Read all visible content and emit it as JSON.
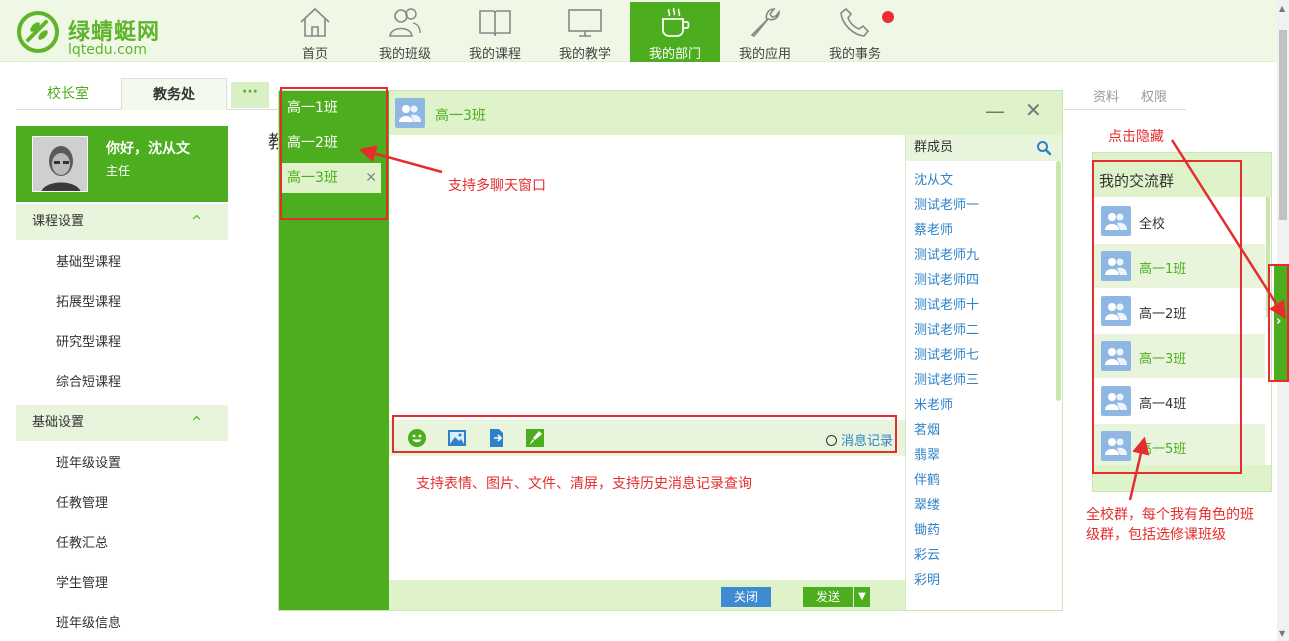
{
  "header": {
    "logo_cn": "绿蜻蜓网",
    "logo_en": "lqtedu.com",
    "nav": [
      {
        "label": "首页",
        "icon": "home-icon"
      },
      {
        "label": "我的班级",
        "icon": "users-icon"
      },
      {
        "label": "我的课程",
        "icon": "book-icon"
      },
      {
        "label": "我的教学",
        "icon": "monitor-icon"
      },
      {
        "label": "我的部门",
        "icon": "coffee-icon",
        "active": true
      },
      {
        "label": "我的应用",
        "icon": "wrench-icon"
      },
      {
        "label": "我的事务",
        "icon": "phone-icon",
        "badge": "red-dot"
      }
    ]
  },
  "tabs": {
    "items": [
      "校长室",
      "教务处"
    ],
    "more": "···",
    "right_links": [
      "资料",
      "权限"
    ]
  },
  "profile": {
    "greeting": "你好，沈从文",
    "role": "主任"
  },
  "sidebar": {
    "sections": [
      {
        "title": "课程设置",
        "items": [
          "基础型课程",
          "拓展型课程",
          "研究型课程",
          "综合短课程"
        ]
      },
      {
        "title": "基础设置",
        "items": [
          "班年级设置",
          "任教管理",
          "任教汇总",
          "学生管理",
          "班年级信息"
        ]
      }
    ],
    "chevron": "^"
  },
  "page": {
    "title_fragment": "教"
  },
  "chat": {
    "tabs": [
      "高一1班",
      "高一2班",
      "高一3班"
    ],
    "active_tab": "高一3班",
    "tab_close": "✕",
    "title": "高一3班",
    "minimize": "—",
    "close": "✕",
    "toolbar_icons": [
      "smile-icon",
      "image-icon",
      "file-icon",
      "brush-icon"
    ],
    "history_label": "消息记录",
    "close_button": "关闭",
    "send_button": "发送",
    "send_dropdown": "▼",
    "members_title": "群成员",
    "members": [
      "沈从文",
      "测试老师一",
      "蔡老师",
      "测试老师九",
      "测试老师四",
      "测试老师十",
      "测试老师二",
      "测试老师七",
      "测试老师三",
      "米老师",
      "茗烟",
      "翡翠",
      "伴鹤",
      "翠缕",
      "锄药",
      "彩云",
      "彩明"
    ]
  },
  "groups": {
    "title": "我的交流群",
    "items": [
      "全校",
      "高一1班",
      "高一2班",
      "高一3班",
      "高一4班",
      "高一5班"
    ],
    "toggle": "›"
  },
  "annotations": {
    "multi_window": "支持多聊天窗口",
    "toolbar_features": "支持表情、图片、文件、清屏，支持历史消息记录查询",
    "hide": "点击隐藏",
    "groups_note_1": "全校群，每个我有角色的班",
    "groups_note_2": "级群，包括选修课班级"
  },
  "colors": {
    "brand_green": "#4cae1e",
    "light_green": "#dff3cb",
    "link_blue": "#2d82c9",
    "annotation_red": "#e52d2d"
  }
}
